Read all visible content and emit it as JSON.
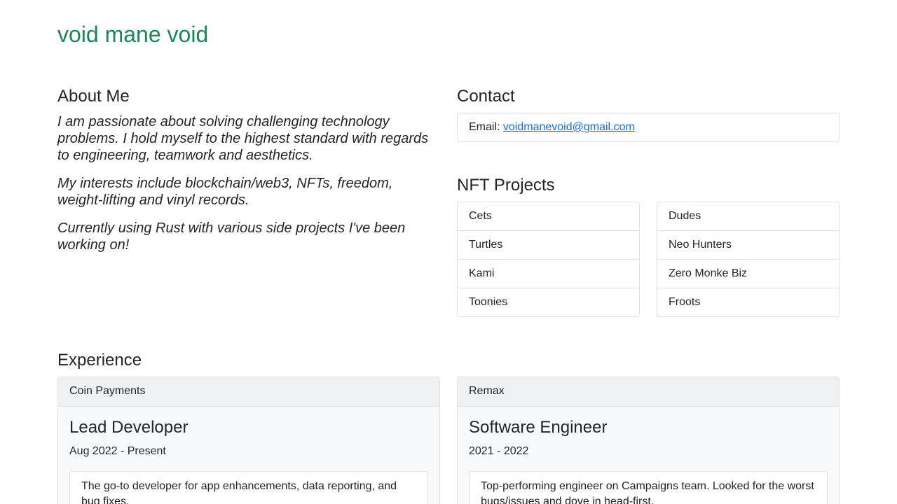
{
  "header": {
    "title": "void mane void"
  },
  "about": {
    "heading": "About Me",
    "paragraphs": [
      "I am passionate about solving challenging technology problems. I hold myself to the highest standard with regards to engineering, teamwork and aesthetics.",
      "My interests include blockchain/web3, NFTs, freedom, weight-lifting and vinyl records.",
      "Currently using Rust with various side projects I've been working on!"
    ]
  },
  "contact": {
    "heading": "Contact",
    "email_label": "Email: ",
    "email": "voidmanevoid@gmail.com"
  },
  "nft": {
    "heading": "NFT Projects",
    "left": [
      "Cets",
      "Turtles",
      "Kami",
      "Toonies"
    ],
    "right": [
      "Dudes",
      "Neo Hunters",
      "Zero Monke Biz",
      "Froots"
    ]
  },
  "experience": {
    "heading": "Experience",
    "jobs": [
      {
        "company": "Coin Payments",
        "title": "Lead Developer",
        "dates": "Aug 2022 - Present",
        "description": "The go-to developer for app enhancements, data reporting, and bug fixes."
      },
      {
        "company": "Remax",
        "title": "Software Engineer",
        "dates": "2021 - 2022",
        "description": "Top-performing engineer on Campaigns team. Looked for the worst bugs/issues and dove in head-first."
      }
    ]
  },
  "colors": {
    "title": "#198754",
    "link": "#0d6efd",
    "border": "#dee2e6"
  }
}
